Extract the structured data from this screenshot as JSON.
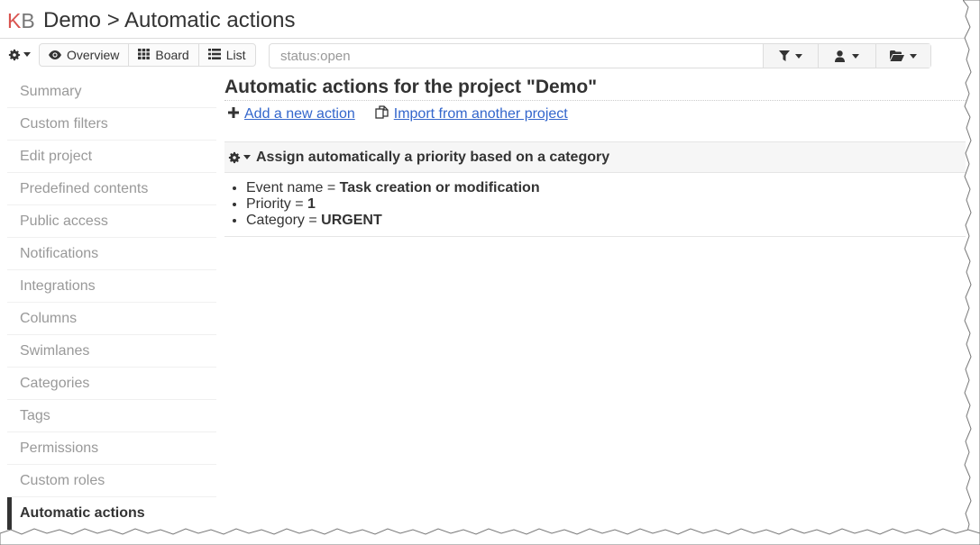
{
  "header": {
    "logo_k": "K",
    "logo_b": "B",
    "title": "Demo > Automatic actions"
  },
  "toolbar": {
    "views": [
      {
        "label": "Overview",
        "icon": "eye-icon"
      },
      {
        "label": "Board",
        "icon": "grid-icon"
      },
      {
        "label": "List",
        "icon": "list-icon"
      }
    ],
    "search": {
      "value": "",
      "placeholder": "status:open"
    },
    "filter_icons": [
      "filter-icon",
      "user-icon",
      "folder-open-icon"
    ]
  },
  "sidebar": {
    "items": [
      {
        "label": "Summary"
      },
      {
        "label": "Custom filters"
      },
      {
        "label": "Edit project"
      },
      {
        "label": "Predefined contents"
      },
      {
        "label": "Public access"
      },
      {
        "label": "Notifications"
      },
      {
        "label": "Integrations"
      },
      {
        "label": "Columns"
      },
      {
        "label": "Swimlanes"
      },
      {
        "label": "Categories"
      },
      {
        "label": "Tags"
      },
      {
        "label": "Permissions"
      },
      {
        "label": "Custom roles"
      },
      {
        "label": "Automatic actions"
      }
    ],
    "active": "Automatic actions"
  },
  "main": {
    "title": "Automatic actions for the project \"Demo\"",
    "add_label": "Add a new action",
    "import_label": "Import from another project",
    "action": {
      "title": "Assign automatically a priority based on a category",
      "params": [
        {
          "name": "Event name = ",
          "value": "Task creation or modification"
        },
        {
          "name": "Priority = ",
          "value": "1"
        },
        {
          "name": "Category = ",
          "value": "URGENT"
        }
      ]
    }
  },
  "colors": {
    "logo_k": "#d9534f",
    "link": "#3366cc",
    "sidebar_inactive": "#999999",
    "text": "#333333"
  }
}
